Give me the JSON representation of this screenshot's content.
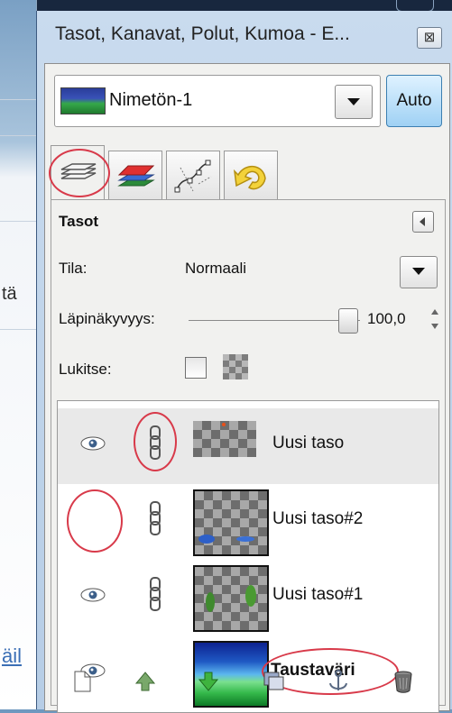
{
  "window": {
    "title": "Tasot, Kanavat, Polut, Kumoa - E...",
    "close_glyph": "⊠"
  },
  "background_app": {
    "fragment_1": "tä",
    "fragment_2": "äil"
  },
  "image_selector": {
    "image_name": "Nimetön-1",
    "auto_label": "Auto"
  },
  "tabs": [
    {
      "name": "layers",
      "icon": "layers-icon",
      "active": true
    },
    {
      "name": "channels",
      "icon": "channels-icon",
      "active": false
    },
    {
      "name": "paths",
      "icon": "paths-icon",
      "active": false
    },
    {
      "name": "undo",
      "icon": "undo-history-icon",
      "active": false
    }
  ],
  "layers_panel": {
    "title": "Tasot",
    "mode_label": "Tila:",
    "mode_value": "Normaali",
    "opacity_label": "Läpinäkyvyys:",
    "opacity_value": "100,0",
    "lock_label": "Lukitse:",
    "layers": [
      {
        "name": "Uusi taso",
        "visible": true,
        "linked": true,
        "selected": true,
        "bold": false
      },
      {
        "name": "Uusi taso#2",
        "visible": false,
        "linked": true,
        "selected": false,
        "bold": false
      },
      {
        "name": "Uusi taso#1",
        "visible": true,
        "linked": true,
        "selected": false,
        "bold": false
      },
      {
        "name": "Taustaväri",
        "visible": true,
        "linked": false,
        "selected": false,
        "bold": true
      }
    ]
  },
  "bottom_toolbar": [
    "new-layer-icon",
    "raise-layer-icon",
    "lower-layer-icon",
    "duplicate-layer-icon",
    "anchor-layer-icon",
    "delete-layer-icon"
  ],
  "colors": {
    "annotation_red": "#d83a4a",
    "auto_button_blue": "#9fd1f4"
  }
}
